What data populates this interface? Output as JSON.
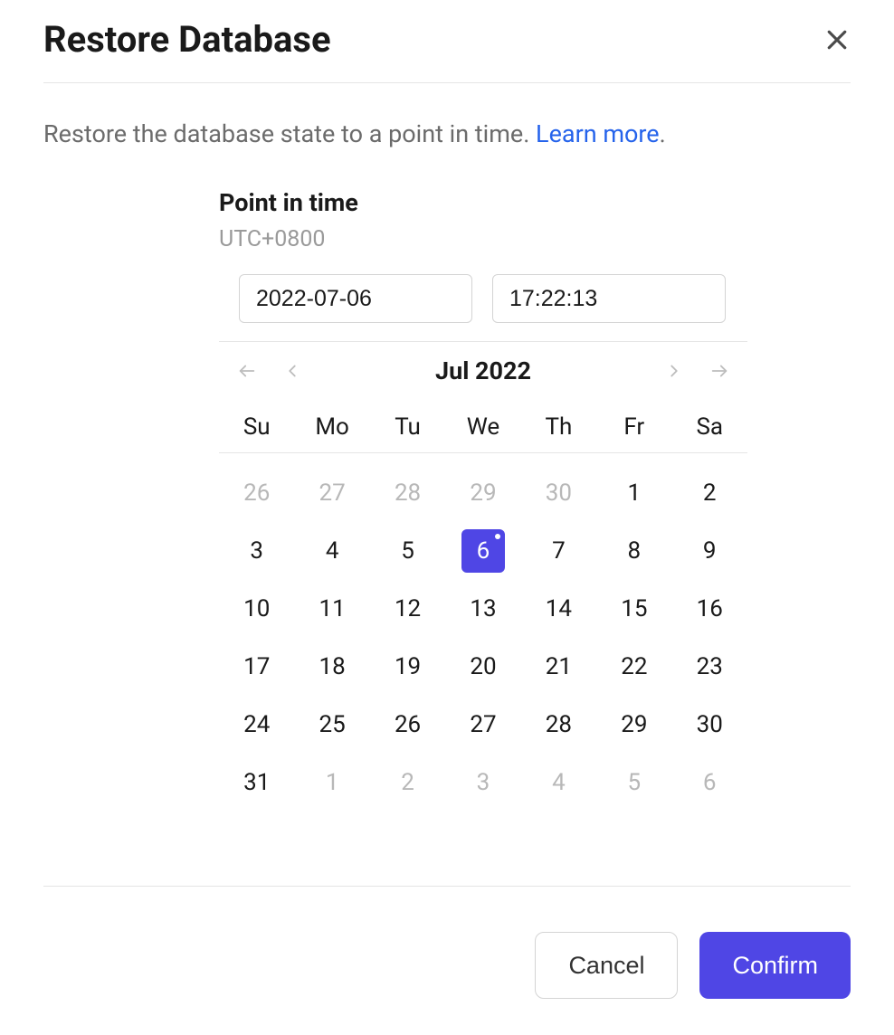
{
  "header": {
    "title": "Restore Database"
  },
  "description": {
    "text": "Restore the database state to a point in time. ",
    "learn_more": "Learn more",
    "period": "."
  },
  "picker": {
    "section_title": "Point in time",
    "timezone": "UTC+0800",
    "date_value": "2022-07-06",
    "time_value": "17:22:13"
  },
  "calendar": {
    "month_label": "Jul 2022",
    "weekdays": [
      "Su",
      "Mo",
      "Tu",
      "We",
      "Th",
      "Fr",
      "Sa"
    ],
    "weeks": [
      [
        {
          "d": "26",
          "muted": true
        },
        {
          "d": "27",
          "muted": true
        },
        {
          "d": "28",
          "muted": true
        },
        {
          "d": "29",
          "muted": true
        },
        {
          "d": "30",
          "muted": true
        },
        {
          "d": "1"
        },
        {
          "d": "2"
        }
      ],
      [
        {
          "d": "3"
        },
        {
          "d": "4"
        },
        {
          "d": "5"
        },
        {
          "d": "6",
          "selected": true
        },
        {
          "d": "7"
        },
        {
          "d": "8"
        },
        {
          "d": "9"
        }
      ],
      [
        {
          "d": "10"
        },
        {
          "d": "11"
        },
        {
          "d": "12"
        },
        {
          "d": "13"
        },
        {
          "d": "14"
        },
        {
          "d": "15"
        },
        {
          "d": "16"
        }
      ],
      [
        {
          "d": "17"
        },
        {
          "d": "18"
        },
        {
          "d": "19"
        },
        {
          "d": "20"
        },
        {
          "d": "21"
        },
        {
          "d": "22"
        },
        {
          "d": "23"
        }
      ],
      [
        {
          "d": "24"
        },
        {
          "d": "25"
        },
        {
          "d": "26"
        },
        {
          "d": "27"
        },
        {
          "d": "28"
        },
        {
          "d": "29"
        },
        {
          "d": "30"
        }
      ],
      [
        {
          "d": "31"
        },
        {
          "d": "1",
          "muted": true
        },
        {
          "d": "2",
          "muted": true
        },
        {
          "d": "3",
          "muted": true
        },
        {
          "d": "4",
          "muted": true
        },
        {
          "d": "5",
          "muted": true
        },
        {
          "d": "6",
          "muted": true
        }
      ]
    ]
  },
  "footer": {
    "cancel": "Cancel",
    "confirm": "Confirm"
  }
}
